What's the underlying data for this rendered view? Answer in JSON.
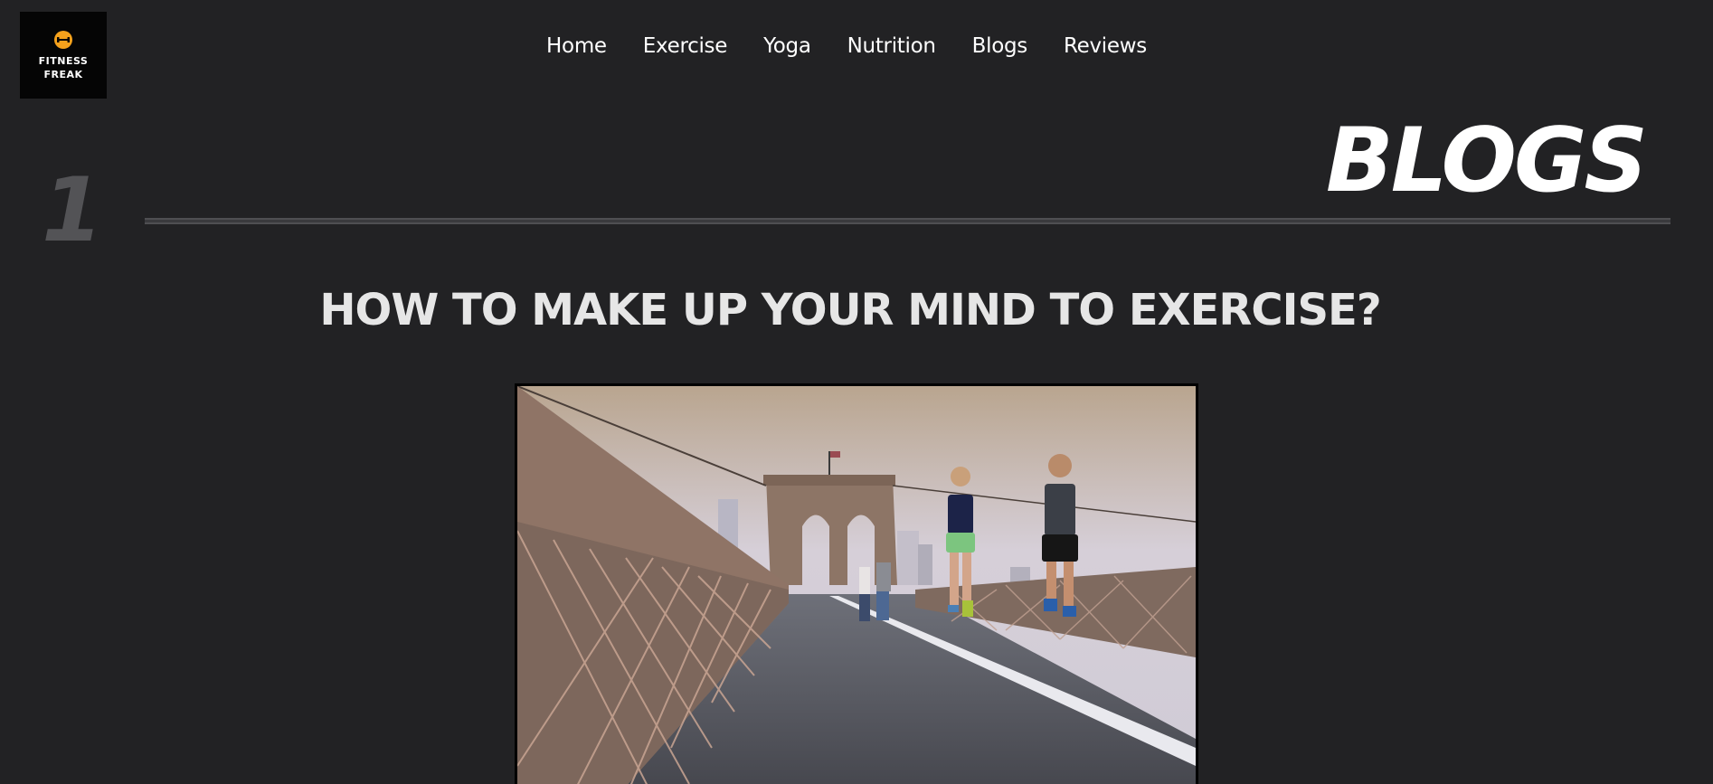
{
  "brand": {
    "line1": "FITNESS",
    "line2": "FREAK",
    "icon": "dumbbell-icon",
    "accent_color": "#f5a11c"
  },
  "nav": {
    "items": [
      {
        "label": "Home"
      },
      {
        "label": "Exercise"
      },
      {
        "label": "Yoga"
      },
      {
        "label": "Nutrition"
      },
      {
        "label": "Blogs"
      },
      {
        "label": "Reviews"
      }
    ]
  },
  "section": {
    "number": "1",
    "title": "BLOGS"
  },
  "article": {
    "title": "HOW TO MAKE UP YOUR MIND TO EXERCISE?"
  },
  "colors": {
    "background": "#222224",
    "text": "#ffffff",
    "muted_number": "#535356"
  }
}
